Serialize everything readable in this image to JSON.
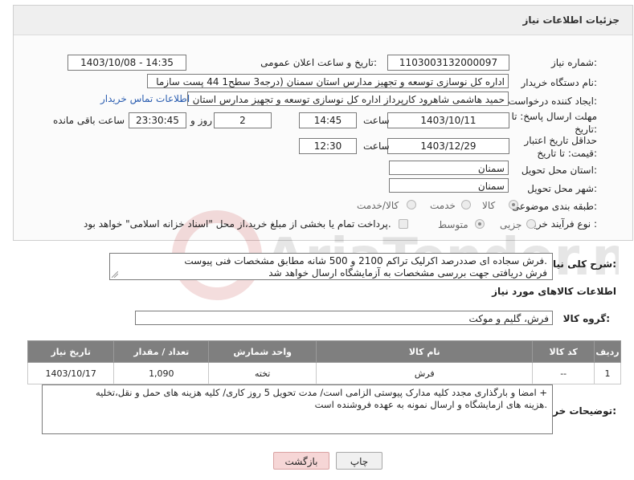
{
  "header": {
    "title": "جزئیات اطلاعات نیاز"
  },
  "fields": {
    "need_number_label": "شماره نیاز:",
    "need_number": "1103003132000097",
    "announce_label": "تاریخ و ساعت اعلان عمومی:",
    "announce_value": "1403/10/08 - 14:35",
    "buyer_org_label": "نام دستگاه خریدار:",
    "buyer_org": "اداره کل نوسازی   توسعه و تجهیز مدارس استان سمنان (درجه3  سطح1  44 پست سازما",
    "creator_label": "ایجاد کننده درخواست:",
    "creator": "حمید هاشمی شاهرود کارپرداز اداره کل نوسازی   توسعه و تجهیز مدارس استان",
    "contact_link": "اطلاعات تماس خریدار",
    "deadline_label": "مهلت ارسال پاسخ: تا تاریخ:",
    "deadline_date": "1403/10/11",
    "time_label": "ساعت",
    "deadline_time": "14:45",
    "days_value": "2",
    "days_label": "روز و",
    "remaining_time": "23:30:45",
    "remaining_label": "ساعت باقی مانده",
    "validity_label": "حداقل تاریخ اعتبار قیمت: تا تاریخ:",
    "validity_date": "1403/12/29",
    "validity_time_label": "ساعت",
    "validity_time": "12:30",
    "province_label": "استان محل تحویل:",
    "province": "سمنان",
    "city_label": "شهر محل تحویل:",
    "city": "سمنان",
    "category_label": "طبقه بندی موضوعی:",
    "category_options": [
      "کالا",
      "خدمت",
      "کالا/خدمت"
    ],
    "process_label": "نوع فرآیند خرید :",
    "process_options": [
      "جزیی",
      "متوسط"
    ],
    "payment_note": "پرداخت تمام یا بخشی از مبلغ خرید،از محل \"اسناد خزانه اسلامی\" خواهد بود."
  },
  "summary": {
    "label": "شرح کلی نیاز:",
    "line1": "فرش سجاده ای صددرصد اکرلیک تراکم 2100 و 500 شانه مطابق مشخصات فنی پیوست.",
    "line2": "فرش دریافتی جهت بررسی مشخصات به آزمایشگاه ارسال خواهد شد"
  },
  "goods": {
    "section_title": "اطلاعات کالاهای مورد نیاز",
    "group_label": "گروه کالا:",
    "group_value": "فرش، گلیم و موکت",
    "columns": [
      "ردیف",
      "کد کالا",
      "نام کالا",
      "واحد شمارش",
      "تعداد / مقدار",
      "تاریخ نیاز"
    ],
    "rows": [
      {
        "index": "1",
        "code": "--",
        "name": "فرش",
        "unit": "تخته",
        "qty": "1,090",
        "date": "1403/10/17"
      }
    ]
  },
  "buyer_notes": {
    "label": "توضیحات خریدار:",
    "line1": "امضا و بارگذاری مجدد کلیه مدارک پیوستی الزامی است/  مدت تحویل 5 روز کاری/  کلیه هزینه های حمل و نقل،تخلیه +",
    "line2": "هزینه های ازمایشگاه و ارسال نمونه به عهده فروشنده است."
  },
  "buttons": {
    "print": "چاپ",
    "back": "بازگشت"
  },
  "colors": {
    "table_header": "#7f7f7f",
    "back_button": "#f6d6d6",
    "print_button": "#f0f0f0",
    "link": "#2a5db0"
  },
  "watermark": "AriaTender.neT"
}
